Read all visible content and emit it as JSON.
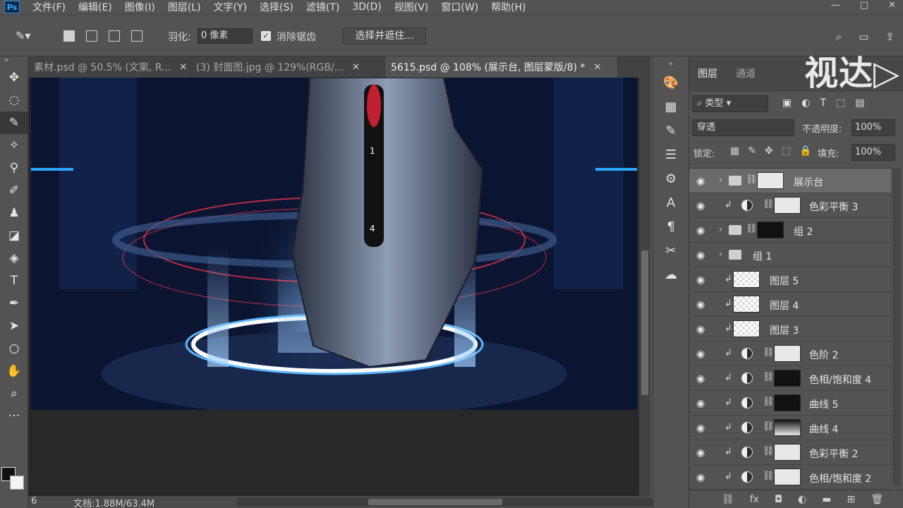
{
  "app": {
    "logo": "Ps"
  },
  "menu": [
    "文件(F)",
    "编辑(E)",
    "图像(I)",
    "图层(L)",
    "文字(Y)",
    "选择(S)",
    "滤镜(T)",
    "3D(D)",
    "视图(V)",
    "窗口(W)",
    "帮助(H)"
  ],
  "window_controls": {
    "minimize": "—",
    "restore": "□",
    "close": "✕"
  },
  "options": {
    "feather_label": "羽化:",
    "feather_value": "0 像素",
    "antialias_label": "消除锯齿",
    "select_mask_button": "选择并遮住..."
  },
  "tabs": [
    {
      "label": "素材.psd @ 50.5% (文案, R...",
      "close": "✕"
    },
    {
      "label": "(3) 封面图.jpg @ 129%(RGB/...",
      "close": "✕"
    },
    {
      "label": "5615.psd @ 108% (展示台, 图层蒙版/8) *",
      "close": "✕"
    }
  ],
  "status": {
    "doc": "文档:1.88M/63.4M",
    "zoom_hint": "6"
  },
  "watermark": "视达▷",
  "layers_panel": {
    "tabs": [
      "图层",
      "通道"
    ],
    "filter_kind": "类型",
    "blend_mode": "穿透",
    "opacity_label": "不透明度:",
    "opacity_value": "100%",
    "lock_label": "锁定:",
    "fill_label": "填充:",
    "fill_value": "100%",
    "layers": [
      {
        "name": "展示台",
        "type": "group-mask",
        "selected": true
      },
      {
        "name": "色彩平衡 3",
        "type": "adjustment",
        "thumb": "white",
        "clipped": true
      },
      {
        "name": "组 2",
        "type": "group-mask",
        "thumb": "blob"
      },
      {
        "name": "组 1",
        "type": "group"
      },
      {
        "name": "图层 5",
        "type": "pixel",
        "clipped": true
      },
      {
        "name": "图层 4",
        "type": "pixel",
        "clipped": true
      },
      {
        "name": "图层 3",
        "type": "pixel",
        "clipped": true
      },
      {
        "name": "色阶 2",
        "type": "adjustment",
        "thumb": "white",
        "clipped": true
      },
      {
        "name": "色相/饱和度 4",
        "type": "adjustment",
        "thumb": "black",
        "clipped": true
      },
      {
        "name": "曲线 5",
        "type": "adjustment",
        "thumb": "black",
        "clipped": true
      },
      {
        "name": "曲线 4",
        "type": "adjustment",
        "thumb": "grad",
        "clipped": true
      },
      {
        "name": "色彩平衡 2",
        "type": "adjustment",
        "thumb": "white",
        "clipped": true
      },
      {
        "name": "色相/饱和度 2",
        "type": "adjustment",
        "thumb": "white",
        "clipped": true
      }
    ]
  }
}
